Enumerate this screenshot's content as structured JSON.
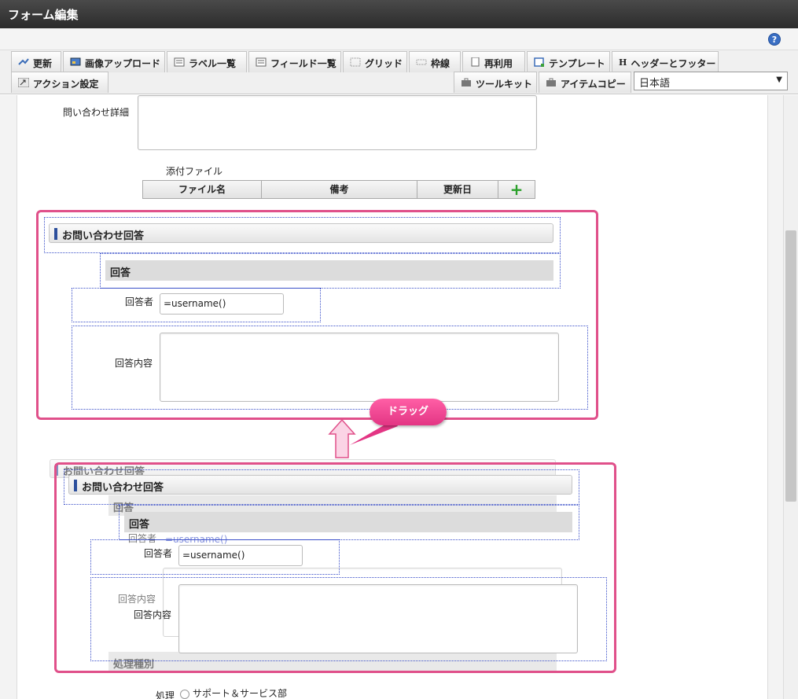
{
  "window": {
    "title": "フォーム編集"
  },
  "toolbar": {
    "row1": [
      {
        "label": "更新",
        "icon": "refresh-icon"
      },
      {
        "label": "画像アップロード",
        "icon": "image-upload-icon"
      },
      {
        "label": "ラベル一覧",
        "icon": "label-list-icon"
      },
      {
        "label": "フィールド一覧",
        "icon": "field-list-icon"
      },
      {
        "label": "グリッド",
        "icon": "grid-icon"
      },
      {
        "label": "枠線",
        "icon": "border-icon"
      },
      {
        "label": "再利用",
        "icon": "reuse-icon"
      },
      {
        "label": "テンプレート",
        "icon": "template-icon"
      },
      {
        "label": "ヘッダーとフッター",
        "icon": "header-footer-icon"
      }
    ],
    "row2_left": {
      "label": "アクション設定",
      "icon": "action-settings-icon"
    },
    "row2_right": [
      {
        "label": "ツールキット",
        "icon": "toolkit-icon"
      },
      {
        "label": "アイテムコピー",
        "icon": "item-copy-icon"
      }
    ],
    "language": "日本語",
    "help": "?"
  },
  "form": {
    "inquiry_detail_label": "問い合わせ詳細",
    "attachment_label": "添付ファイル",
    "attachment_columns": [
      "ファイル名",
      "備考",
      "更新日"
    ],
    "add_symbol": "+",
    "section_title": "お問い合わせ回答",
    "answer_heading": "回答",
    "responder_label": "回答者",
    "responder_value": "=username()",
    "answer_content_label": "回答内容",
    "process_type_label": "処理種別",
    "process_label": "処理",
    "process_option": "サポート＆サービス部"
  },
  "annotation": {
    "drag_label": "ドラッグ"
  },
  "colors": {
    "highlight": "#e0508a",
    "accent": "#2c4f9c",
    "dotted": "#3a4fc9"
  }
}
